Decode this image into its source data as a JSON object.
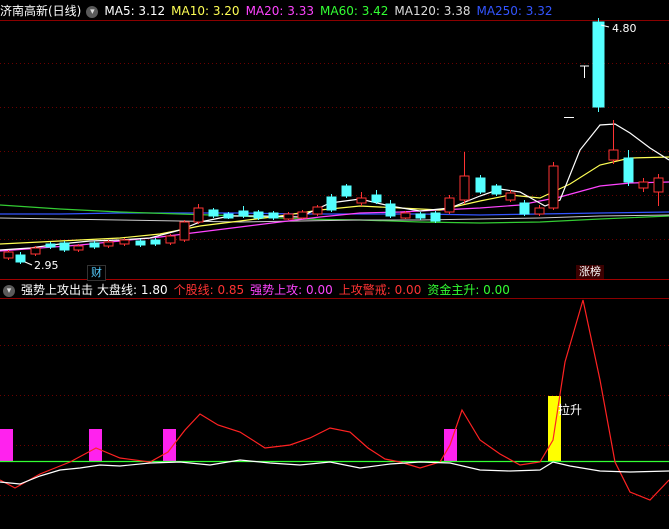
{
  "top_legend": {
    "stock_name": "济南高新(日线)",
    "items": [
      {
        "label": "MA5: ",
        "value": "3.12",
        "color": "#ffffff"
      },
      {
        "label": "MA10: ",
        "value": "3.20",
        "color": "#ffff55"
      },
      {
        "label": "MA20: ",
        "value": "3.33",
        "color": "#ff44ff"
      },
      {
        "label": "MA60: ",
        "value": "3.42",
        "color": "#33ff33"
      },
      {
        "label": "MA120: ",
        "value": "3.38",
        "color": "#dddddd"
      },
      {
        "label": "MA250: ",
        "value": "3.32",
        "color": "#3355ff"
      }
    ]
  },
  "price_labels": {
    "high": "4.80",
    "low": "2.95"
  },
  "badges": {
    "cai": "财",
    "zhangbang": "涨榜"
  },
  "bottom_legend": {
    "indicator": "强势上攻出击",
    "items": [
      {
        "label": "大盘线: ",
        "value": "1.80",
        "color": "#ffffff"
      },
      {
        "label": "个股线: ",
        "value": "0.85",
        "color": "#ff3333"
      },
      {
        "label": "强势上攻: ",
        "value": "0.00",
        "color": "#ff44ff"
      },
      {
        "label": "上攻警戒: ",
        "value": "0.00",
        "color": "#ff3333"
      },
      {
        "label": "资金主升: ",
        "value": "0.00",
        "color": "#33ff33"
      }
    ]
  },
  "signal_text": "拉升"
}
